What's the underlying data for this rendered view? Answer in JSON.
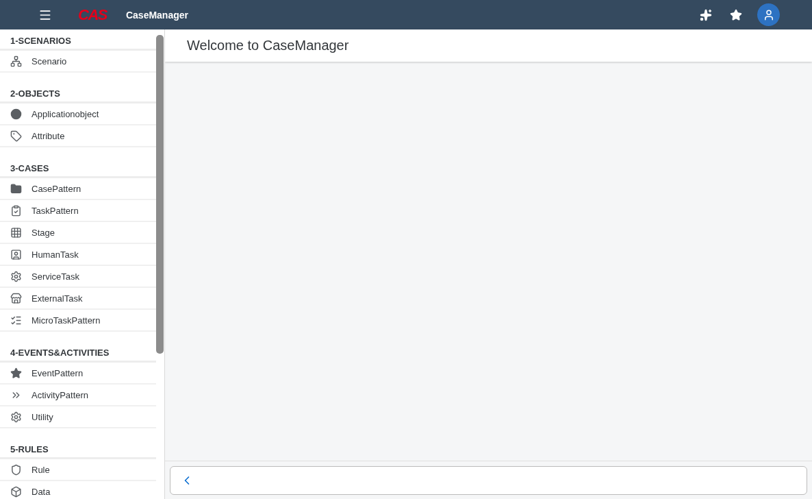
{
  "header": {
    "logo": "CAS",
    "app_title": "CaseManager"
  },
  "sidebar": {
    "groups": [
      {
        "title": "1-SCENARIOS",
        "items": [
          {
            "label": "Scenario"
          }
        ]
      },
      {
        "title": "2-OBJECTS",
        "items": [
          {
            "label": "Applicationobject"
          },
          {
            "label": "Attribute"
          }
        ]
      },
      {
        "title": "3-CASES",
        "items": [
          {
            "label": "CasePattern"
          },
          {
            "label": "TaskPattern"
          },
          {
            "label": "Stage"
          },
          {
            "label": "HumanTask"
          },
          {
            "label": "ServiceTask"
          },
          {
            "label": "ExternalTask"
          },
          {
            "label": "MicroTaskPattern"
          }
        ]
      },
      {
        "title": "4-EVENTS&ACTIVITIES",
        "items": [
          {
            "label": "EventPattern"
          },
          {
            "label": "ActivityPattern"
          },
          {
            "label": "Utility"
          }
        ]
      },
      {
        "title": "5-RULES",
        "items": [
          {
            "label": "Rule"
          },
          {
            "label": "Data"
          }
        ]
      }
    ]
  },
  "main": {
    "title": "Welcome to CaseManager"
  }
}
